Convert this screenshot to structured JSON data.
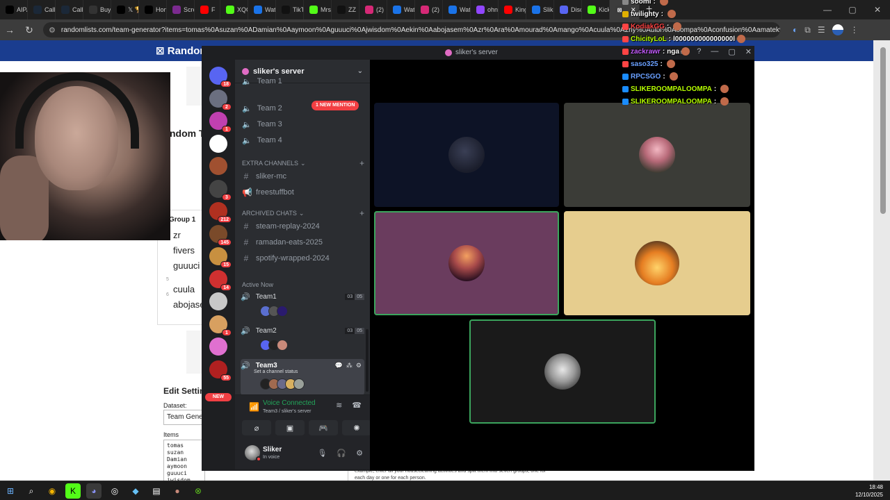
{
  "browser": {
    "tabs": [
      {
        "label": "AIPA",
        "icon": "x-icon",
        "color": "#000000"
      },
      {
        "label": "Call",
        "icon": "steam-icon",
        "color": "#1b2838"
      },
      {
        "label": "Call",
        "icon": "steam-icon",
        "color": "#1b2838"
      },
      {
        "label": "Buy",
        "icon": "github-icon",
        "color": "#333333"
      },
      {
        "label": "𝕏 🏆",
        "icon": "x-icon",
        "color": "#000000"
      },
      {
        "label": "Hon",
        "icon": "x-icon",
        "color": "#000000"
      },
      {
        "label": "Scre",
        "icon": "pen-icon",
        "color": "#7b2a8f"
      },
      {
        "label": "F",
        "icon": "youtube-icon",
        "color": "#ff0000"
      },
      {
        "label": "XQC",
        "icon": "kick-icon",
        "color": "#53fc18"
      },
      {
        "label": "Wat",
        "icon": "globe-icon",
        "color": "#1a73e8"
      },
      {
        "label": "TikT",
        "icon": "tiktok-icon",
        "color": "#111111"
      },
      {
        "label": "Mrs",
        "icon": "kick-icon",
        "color": "#53fc18"
      },
      {
        "label": "ZZ",
        "icon": "tiktok-icon",
        "color": "#111111"
      },
      {
        "label": "(2)",
        "icon": "instagram-icon",
        "color": "#d62976"
      },
      {
        "label": "Wat",
        "icon": "globe-icon",
        "color": "#1a73e8"
      },
      {
        "label": "(2)",
        "icon": "instagram-icon",
        "color": "#d62976"
      },
      {
        "label": "Wat",
        "icon": "globe-icon",
        "color": "#1a73e8"
      },
      {
        "label": "ohn",
        "icon": "twitch-icon",
        "color": "#9146ff"
      },
      {
        "label": "King",
        "icon": "youtube-icon",
        "color": "#ff0000"
      },
      {
        "label": "Slik",
        "icon": "globe-icon",
        "color": "#1a73e8"
      },
      {
        "label": "Disc",
        "icon": "globe-icon",
        "color": "#5865f2"
      },
      {
        "label": "Kick",
        "icon": "kick-icon",
        "color": "#53fc18"
      }
    ],
    "active_tab_label": "",
    "new_tab": "+",
    "url": "randomlists.com/team-generator?items=tomas%0Asuzan%0ADamian%0Aaymoon%0Aguuuci%0Ajwisdom%0Aekin%0Aabojasem%0Azr%0Ara%0Amourad%0Amango%0Acuula%0A2ny%0Auibi%0Aoompa%0Aconfusion%0Aamatek%0Afivers%0..."
  },
  "page": {
    "logo": "⊠ Random",
    "title_fragment": "ndom Te",
    "group_title": "Group 1",
    "group_items": [
      "zr",
      "fivers",
      "guuuci",
      "cuula",
      "abojasem"
    ],
    "group_nums": [
      "5",
      "6"
    ],
    "edit_title": "Edit Setting",
    "dataset_label": "Dataset:",
    "dataset_value": "Team Generator",
    "items_label": "Items",
    "items_text": "tomas\nsuzan\nDamian\naymoon\nguuuci\njwisdom",
    "help_text": "example, enter all your housecleaning activities and split them into seven groups, one for each day or one for each person."
  },
  "discord": {
    "window_title": "sliker's server",
    "server_name": "sliker's server",
    "guild_badges": [
      "18",
      "2",
      "1",
      "",
      "",
      "3",
      "212",
      "145",
      "15",
      "14",
      "",
      "1",
      "",
      "55"
    ],
    "new_label": "NEW",
    "mention_label": "1 NEW MENTION",
    "voice_channels_top": [
      "Team 1",
      "Team 2",
      "Team 3",
      "Team 4"
    ],
    "extra_category": "EXTRA CHANNELS",
    "extra_channels": [
      "sliker-mc",
      "freestuffbot"
    ],
    "archived_category": "ARCHIVED CHATS",
    "archived_channels": [
      "steam-replay-2024",
      "ramadan-eats-2025",
      "spotify-wrapped-2024"
    ],
    "active_now": "Active Now",
    "active_voice": [
      {
        "name": "Team1",
        "count_a": "03",
        "count_b": "05"
      },
      {
        "name": "Team2",
        "count_a": "03",
        "count_b": "05"
      },
      {
        "name": "Team3",
        "status": "Set a channel status"
      }
    ],
    "voice_connected": "Voice Connected",
    "voice_location": "Team3 / sliker's server",
    "user_name": "Sliker",
    "user_status": "In voice"
  },
  "stream_chat": [
    {
      "user": "soomi",
      "text": "",
      "color": "#ffffff",
      "badge": "#888888"
    },
    {
      "user": "twilighty",
      "text": "",
      "color": "#ffffff",
      "badge": "#e0b000"
    },
    {
      "user": "KodiakGG",
      "text": "",
      "color": "#ff4444",
      "badge": "#ff4444"
    },
    {
      "user": "ChicityLoL",
      "text": "l000000000000000l",
      "color": "#b6ff00",
      "badge": "#ff4444"
    },
    {
      "user": "zackrawr",
      "text": "nga",
      "color": "#c45cff",
      "badge": "#ff4444"
    },
    {
      "user": "saso325",
      "text": "",
      "color": "#6aa0ff",
      "badge": "#ff4444"
    },
    {
      "user": "RPCSGO",
      "text": "",
      "color": "#6aa0ff",
      "badge": "#1a8cff"
    },
    {
      "user": "SLIKEROOMPALOOMPA",
      "text": "",
      "color": "#b6ff00",
      "badge": "#1a8cff"
    },
    {
      "user": "SLIKEROOMPALOOMPA",
      "text": "",
      "color": "#b6ff00",
      "badge": "#1a8cff"
    }
  ],
  "taskbar": {
    "time": "18:48",
    "date": "12/10/2025"
  }
}
